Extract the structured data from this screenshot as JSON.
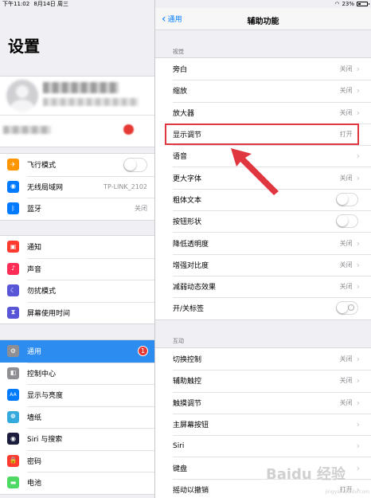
{
  "status": {
    "time": "下午11:02",
    "date": "8月14日 周三",
    "battery": "23%",
    "battery_level": 0.23
  },
  "left": {
    "title": "设置",
    "group1": [
      {
        "label": "飞行模式",
        "icon": "airplane-icon",
        "color": "#ff9500",
        "glyph": "✈",
        "type": "toggle"
      },
      {
        "label": "无线局域网",
        "icon": "wifi-icon",
        "color": "#007aff",
        "glyph": "◉",
        "value": "TP-LINK_2102"
      },
      {
        "label": "蓝牙",
        "icon": "bluetooth-icon",
        "color": "#007aff",
        "glyph": "ᛒ",
        "value": "关闭"
      }
    ],
    "group2": [
      {
        "label": "通知",
        "icon": "notification-icon",
        "color": "#ff3b30",
        "glyph": "▣"
      },
      {
        "label": "声音",
        "icon": "sound-icon",
        "color": "#ff2d55",
        "glyph": "♪"
      },
      {
        "label": "勿扰模式",
        "icon": "moon-icon",
        "color": "#5856d6",
        "glyph": "☾"
      },
      {
        "label": "屏幕使用时间",
        "icon": "hourglass-icon",
        "color": "#5856d6",
        "glyph": "⧗"
      }
    ],
    "group3": [
      {
        "label": "通用",
        "icon": "gear-icon",
        "color": "#8e8e93",
        "glyph": "⚙",
        "badge": "1",
        "selected": true
      },
      {
        "label": "控制中心",
        "icon": "control-center-icon",
        "color": "#8e8e93",
        "glyph": "◧"
      },
      {
        "label": "显示与亮度",
        "icon": "display-icon",
        "color": "#007aff",
        "glyph": "AA"
      },
      {
        "label": "墙纸",
        "icon": "wallpaper-icon",
        "color": "#34aadc",
        "glyph": "❁"
      },
      {
        "label": "Siri 与搜索",
        "icon": "siri-icon",
        "color": "#1c1c3c",
        "glyph": "◉"
      },
      {
        "label": "密码",
        "icon": "lock-icon",
        "color": "#ff3b30",
        "glyph": "🔒"
      },
      {
        "label": "电池",
        "icon": "battery-icon",
        "color": "#4cd964",
        "glyph": "▬"
      }
    ]
  },
  "right": {
    "back_label": "通用",
    "title": "辅助功能",
    "section1_header": "视觉",
    "section1": [
      {
        "label": "旁白",
        "value": "关闭",
        "chevron": true
      },
      {
        "label": "缩放",
        "value": "关闭",
        "chevron": true
      },
      {
        "label": "放大器",
        "value": "关闭",
        "chevron": true
      },
      {
        "label": "显示调节",
        "value": "打开",
        "chevron": true
      },
      {
        "label": "语音",
        "value": "",
        "chevron": true
      },
      {
        "label": "更大字体",
        "value": "关闭",
        "chevron": true
      },
      {
        "label": "粗体文本",
        "toggle": true
      },
      {
        "label": "按钮形状",
        "toggle": true
      },
      {
        "label": "降低透明度",
        "value": "关闭",
        "chevron": true
      },
      {
        "label": "增强对比度",
        "value": "关闭",
        "chevron": true
      },
      {
        "label": "减弱动态效果",
        "value": "关闭",
        "chevron": true
      },
      {
        "label": "开/关标签",
        "toggle": true,
        "labels": true
      }
    ],
    "section2_header": "互动",
    "section2": [
      {
        "label": "切换控制",
        "value": "关闭",
        "chevron": true
      },
      {
        "label": "辅助触控",
        "value": "关闭",
        "chevron": true
      },
      {
        "label": "触摸调节",
        "value": "关闭",
        "chevron": true
      },
      {
        "label": "主屏幕按钮",
        "value": "",
        "chevron": true
      },
      {
        "label": "Siri",
        "value": "",
        "chevron": true
      },
      {
        "label": "键盘",
        "value": "",
        "chevron": true
      },
      {
        "label": "摇动以撤销",
        "value": "打开",
        "chevron": true
      }
    ]
  },
  "watermark": {
    "text": "Baidu 经验",
    "sub": "jingyan.baidu.com"
  },
  "colors": {
    "accent": "#007aff",
    "selected": "#2d8cf0",
    "highlight": "#e0363f"
  }
}
